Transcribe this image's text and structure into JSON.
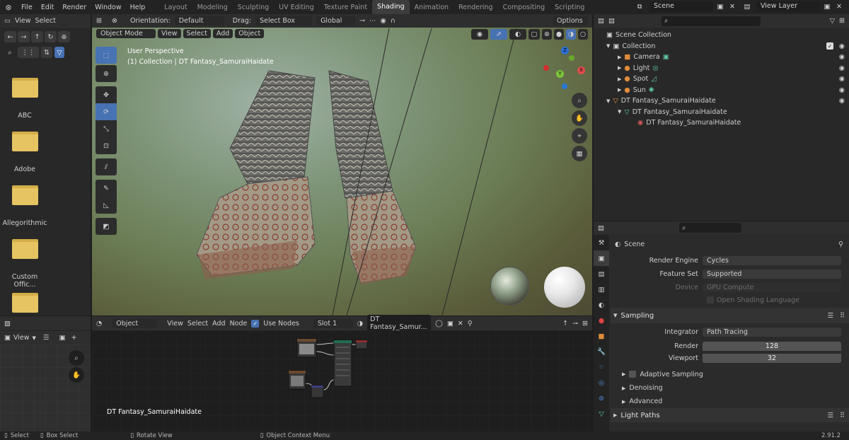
{
  "topbar": {
    "menus": [
      "File",
      "Edit",
      "Render",
      "Window",
      "Help"
    ],
    "workspaces": [
      "Layout",
      "Modeling",
      "Sculpting",
      "UV Editing",
      "Texture Paint",
      "Shading",
      "Animation",
      "Rendering",
      "Compositing",
      "Scripting"
    ],
    "active_workspace": "Shading",
    "scene": "Scene",
    "view_layer": "View Layer"
  },
  "filebrowser": {
    "view_label": "View",
    "select_label": "Select",
    "folders": [
      "ABC",
      "Adobe",
      "Allegorithmic",
      "Custom Offic...",
      ""
    ]
  },
  "viewport": {
    "orientation_label": "Orientation:",
    "orientation_value": "Default",
    "drag_label": "Drag:",
    "drag_value": "Select Box",
    "transform_value": "Global",
    "options_label": "Options",
    "mode": "Object Mode",
    "menu": [
      "View",
      "Select",
      "Add",
      "Object"
    ],
    "overlay_title": "User Perspective",
    "overlay_sub": "(1) Collection | DT Fantasy_SamuraiHaidate",
    "gizmo": {
      "z": "Z",
      "x": "X",
      "y": "Y"
    }
  },
  "imageeditor": {
    "view_label": "View"
  },
  "nodeeditor": {
    "type": "Object",
    "menu": [
      "View",
      "Select",
      "Add",
      "Node"
    ],
    "use_nodes_label": "Use Nodes",
    "slot": "Slot 1",
    "material": "DT Fantasy_Samur...",
    "object_label": "DT Fantasy_SamuraiHaidate"
  },
  "outliner": {
    "items": [
      {
        "label": "Scene Collection",
        "indent": 0,
        "icon": "scene-collection-icon"
      },
      {
        "label": "Collection",
        "indent": 1,
        "icon": "collection-icon"
      },
      {
        "label": "Camera",
        "indent": 2,
        "icon": "camera-icon"
      },
      {
        "label": "Light",
        "indent": 2,
        "icon": "light-icon"
      },
      {
        "label": "Spot",
        "indent": 2,
        "icon": "light-icon"
      },
      {
        "label": "Sun",
        "indent": 2,
        "icon": "light-icon"
      },
      {
        "label": "DT Fantasy_SamuraiHaidate",
        "indent": 1,
        "icon": "mesh-object-icon"
      },
      {
        "label": "DT Fantasy_SamuraiHaidate",
        "indent": 2,
        "icon": "mesh-data-icon"
      },
      {
        "label": "DT Fantasy_SamuraiHaidate",
        "indent": 3,
        "icon": "material-icon"
      }
    ]
  },
  "properties": {
    "context": "Scene",
    "render_engine_label": "Render Engine",
    "render_engine": "Cycles",
    "feature_set_label": "Feature Set",
    "feature_set": "Supported",
    "device_label": "Device",
    "device": "GPU Compute",
    "osl_label": "Open Shading Language",
    "sampling_label": "Sampling",
    "integrator_label": "Integrator",
    "integrator": "Path Tracing",
    "render_label": "Render",
    "render_value": "128",
    "viewport_label": "Viewport",
    "viewport_value": "32",
    "adaptive_label": "Adaptive Sampling",
    "denoising_label": "Denoising",
    "advanced_label": "Advanced",
    "light_paths_label": "Light Paths"
  },
  "statusbar": {
    "select": "Select",
    "box_select": "Box Select",
    "rotate": "Rotate View",
    "context_menu": "Object Context Menu",
    "version": "2.91.2"
  },
  "colors": {
    "accent": "#4772b3",
    "bg": "#1d1d1d",
    "panel": "#2e2e2e"
  }
}
